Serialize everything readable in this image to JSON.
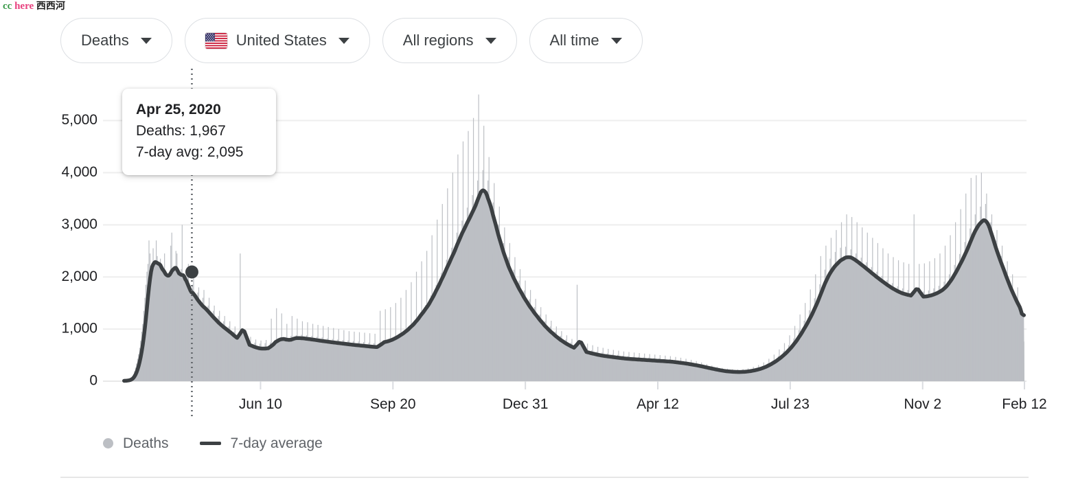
{
  "watermark": {
    "part1": "cc",
    "part2": "here",
    "part3": "西西河",
    "color1": "#3a9a4a",
    "color2": "#e8427f",
    "color3": "#1b1b1b"
  },
  "filters": [
    {
      "name": "metric",
      "label": "Deaths",
      "icon": "chevron-down-icon",
      "flag": false
    },
    {
      "name": "location",
      "label": "United States",
      "icon": "chevron-down-icon",
      "flag": true,
      "flag_name": "us-flag-icon"
    },
    {
      "name": "regions",
      "label": "All regions",
      "icon": "chevron-down-icon",
      "flag": false
    },
    {
      "name": "timerange",
      "label": "All time",
      "icon": "chevron-down-icon",
      "flag": false
    }
  ],
  "tooltip": {
    "date": "Apr 25, 2020",
    "line1": "Deaths: 1,967",
    "line2": "7-day avg: 2,095"
  },
  "legend": [
    {
      "label": "Deaths",
      "marker": "dot",
      "color": "#bcbfc4"
    },
    {
      "label": "7-day average",
      "marker": "line",
      "color": "#3c4043"
    }
  ],
  "colors": {
    "bars": "#bcbfc4",
    "area": "#bcbfc4",
    "line": "#3c4043",
    "grid": "#eeeeee",
    "text": "#202124",
    "muted_text": "#5f6368",
    "chip_border": "#dcdfe3",
    "divider": "#e6e6e6"
  },
  "chart_data": {
    "type": "bar",
    "title": "",
    "xlabel": "",
    "ylabel": "",
    "ylim": [
      0,
      5600
    ],
    "yticks": [
      0,
      1000,
      2000,
      3000,
      4000,
      5000
    ],
    "ytick_labels": [
      "0",
      "1,000",
      "2,000",
      "3,000",
      "4,000",
      "5,000"
    ],
    "xtick_labels": [
      "Jun 10",
      "Sep 20",
      "Dec 31",
      "Apr 12",
      "Jul 23",
      "Nov 2",
      "Feb 12"
    ],
    "xtick_positions": [
      0.152,
      0.299,
      0.446,
      0.593,
      0.74,
      0.887,
      1.0
    ],
    "grid": true,
    "legend_position": "bottom-left",
    "hover": {
      "x_fraction": 0.0758,
      "value": 1967,
      "avg": 2095,
      "label": "Apr 25, 2020"
    },
    "series": [
      {
        "name": "Deaths",
        "type": "bar",
        "color": "#bcbfc4",
        "values": [
          5,
          8,
          12,
          18,
          25,
          30,
          42,
          60,
          90,
          130,
          190,
          260,
          340,
          430,
          520,
          640,
          780,
          950,
          1100,
          1350,
          1600,
          1850,
          2100,
          2250,
          2700,
          2450,
          1900,
          2100,
          2550,
          2200,
          2050,
          2700,
          2400,
          1850,
          2000,
          2350,
          2200,
          1700,
          1900,
          2450,
          2100,
          1800,
          1750,
          2050,
          1967,
          2600,
          2850,
          2050,
          1750,
          1600,
          2500,
          2450,
          1900,
          1700,
          1650,
          2150,
          3000,
          1800,
          1600,
          1500,
          1400,
          2050,
          2250,
          1550,
          1400,
          1350,
          1850,
          2000,
          1500,
          1300,
          1200,
          1700,
          1800,
          1350,
          1200,
          1150,
          1600,
          1750,
          1250,
          1100,
          1050,
          1450,
          1600,
          1150,
          1000,
          980,
          1350,
          1450,
          1050,
          900,
          880,
          1250,
          1350,
          960,
          850,
          800,
          1150,
          1250,
          900,
          780,
          760,
          1050,
          1150,
          820,
          700,
          680,
          950,
          1050,
          760,
          640,
          620,
          880,
          2450,
          700,
          600,
          580,
          830,
          900,
          660,
          560,
          540,
          780,
          850,
          620,
          530,
          510,
          740,
          800,
          600,
          510,
          500,
          720,
          780,
          600,
          520,
          510,
          730,
          790,
          610,
          530,
          520,
          740,
          1200,
          640,
          560,
          550,
          780,
          1400,
          680,
          600,
          590,
          830,
          1300,
          700,
          620,
          610,
          850,
          1100,
          720,
          640,
          630,
          870,
          1250,
          740,
          650,
          640,
          880,
          1200,
          750,
          660,
          650,
          890,
          1150,
          740,
          650,
          640,
          880,
          1130,
          730,
          640,
          630,
          870,
          1100,
          720,
          630,
          620,
          850,
          1080,
          700,
          620,
          610,
          840,
          1060,
          690,
          610,
          600,
          820,
          1040,
          680,
          600,
          590,
          810,
          1020,
          670,
          590,
          580,
          800,
          1000,
          660,
          580,
          570,
          790,
          980,
          650,
          570,
          560,
          780,
          960,
          640,
          560,
          550,
          770,
          950,
          630,
          550,
          540,
          760,
          940,
          620,
          540,
          530,
          750,
          930,
          610,
          530,
          520,
          740,
          920,
          600,
          520,
          510,
          730,
          910,
          600,
          520,
          510,
          730,
          1350,
          610,
          530,
          520,
          740,
          1380,
          640,
          560,
          550,
          780,
          1420,
          680,
          600,
          590,
          830,
          1500,
          740,
          650,
          640,
          890,
          1600,
          800,
          700,
          690,
          960,
          1750,
          880,
          770,
          760,
          1060,
          1900,
          960,
          850,
          840,
          1180,
          2100,
          1080,
          950,
          940,
          1320,
          2300,
          1200,
          1050,
          1040,
          1460,
          2500,
          1350,
          1180,
          1170,
          1650,
          2800,
          1520,
          1330,
          1320,
          1850,
          3100,
          1700,
          1500,
          1480,
          2080,
          3400,
          1900,
          1680,
          1660,
          2330,
          3700,
          2100,
          1850,
          1830,
          2560,
          4000,
          2300,
          2050,
          2030,
          2850,
          4350,
          2500,
          2230,
          2200,
          3080,
          4600,
          2700,
          2400,
          2380,
          3330,
          4800,
          2900,
          2580,
          2550,
          3570,
          5050,
          3100,
          2800,
          2750,
          3850,
          5500,
          3350,
          2950,
          2900,
          4050,
          4900,
          3200,
          2800,
          2750,
          3850,
          4300,
          2900,
          2500,
          2450,
          3430,
          3800,
          2550,
          2200,
          2150,
          3000,
          3350,
          2250,
          1950,
          1900,
          2650,
          2950,
          2000,
          1720,
          1700,
          2380,
          2650,
          1800,
          1550,
          1530,
          2140,
          2380,
          1620,
          1400,
          1380,
          1930,
          2150,
          1460,
          1260,
          1240,
          1740,
          1930,
          1320,
          1140,
          1120,
          1570,
          1750,
          1190,
          1030,
          1010,
          1420,
          1580,
          1080,
          930,
          910,
          1280,
          1420,
          970,
          840,
          820,
          1150,
          1280,
          880,
          760,
          750,
          1050,
          1160,
          800,
          690,
          680,
          950,
          1050,
          730,
          630,
          620,
          870,
          960,
          670,
          580,
          570,
          800,
          880,
          620,
          540,
          530,
          740,
          810,
          580,
          500,
          490,
          690,
          1850,
          540,
          470,
          460,
          650,
          760,
          510,
          450,
          440,
          620,
          720,
          490,
          430,
          420,
          590,
          690,
          470,
          410,
          400,
          570,
          660,
          450,
          395,
          385,
          550,
          640,
          440,
          385,
          375,
          535,
          620,
          430,
          375,
          365,
          520,
          600,
          420,
          365,
          355,
          505,
          585,
          410,
          355,
          345,
          490,
          570,
          400,
          350,
          340,
          480,
          560,
          395,
          345,
          335,
          470,
          550,
          390,
          340,
          330,
          465,
          540,
          385,
          335,
          325,
          455,
          530,
          380,
          330,
          320,
          450,
          520,
          375,
          325,
          315,
          440,
          510,
          370,
          320,
          310,
          435,
          500,
          365,
          315,
          305,
          425,
          490,
          360,
          310,
          300,
          420,
          480,
          350,
          300,
          290,
          405,
          465,
          340,
          290,
          280,
          390,
          450,
          325,
          280,
          270,
          375,
          430,
          310,
          265,
          255,
          355,
          410,
          295,
          250,
          240,
          335,
          385,
          275,
          235,
          225,
          310,
          360,
          255,
          215,
          205,
          285,
          330,
          235,
          200,
          190,
          260,
          300,
          215,
          180,
          175,
          240,
          275,
          195,
          165,
          160,
          220,
          255,
          180,
          155,
          150,
          205,
          240,
          175,
          150,
          145,
          195,
          230,
          170,
          148,
          144,
          190,
          225,
          172,
          152,
          148,
          195,
          232,
          180,
          160,
          156,
          205,
          248,
          195,
          175,
          170,
          225,
          275,
          215,
          195,
          190,
          250,
          310,
          245,
          225,
          218,
          290,
          360,
          285,
          265,
          258,
          340,
          430,
          340,
          315,
          305,
          400,
          510,
          405,
          375,
          365,
          480,
          610,
          480,
          445,
          435,
          575,
          730,
          570,
          530,
          520,
          690,
          880,
          680,
          630,
          620,
          820,
          1060,
          810,
          750,
          740,
          980,
          1280,
          960,
          890,
          875,
          1160,
          1500,
          1130,
          1050,
          1030,
          1360,
          1760,
          1320,
          1230,
          1210,
          1590,
          2050,
          1540,
          1440,
          1410,
          1860,
          2400,
          1780,
          1670,
          1640,
          2140,
          2600,
          1960,
          1840,
          1810,
          2350,
          2750,
          2080,
          1950,
          1920,
          2480,
          2900,
          2150,
          2020,
          1990,
          2560,
          3050,
          2180,
          2030,
          2000,
          2580,
          3200,
          2150,
          1990,
          1960,
          2530,
          3150,
          2090,
          1930,
          1900,
          2450,
          3050,
          2020,
          1860,
          1830,
          2370,
          2950,
          1950,
          1790,
          1760,
          2280,
          2850,
          1870,
          1720,
          1690,
          2190,
          2750,
          1800,
          1650,
          1620,
          2100,
          2650,
          1730,
          1590,
          1560,
          2020,
          2550,
          1670,
          1530,
          1500,
          1940,
          2450,
          1610,
          1480,
          1450,
          1880,
          2380,
          1560,
          1430,
          1400,
          1820,
          2320,
          1520,
          1400,
          1370,
          1780,
          2280,
          1500,
          1380,
          1350,
          1750,
          2250,
          1480,
          1360,
          1330,
          1730,
          3200,
          1470,
          1350,
          1320,
          1720,
          2250,
          1470,
          1350,
          1320,
          1720,
          2260,
          1480,
          1360,
          1340,
          1740,
          2300,
          1510,
          1390,
          1360,
          1780,
          2360,
          1550,
          1430,
          1400,
          1830,
          2450,
          1610,
          1490,
          1460,
          1910,
          2600,
          1720,
          1600,
          1570,
          2050,
          2800,
          1860,
          1740,
          1710,
          2230,
          3050,
          2030,
          1900,
          1870,
          2440,
          3300,
          2210,
          2070,
          2040,
          2670,
          3600,
          2420,
          2280,
          2250,
          2930,
          3900,
          2650,
          2500,
          2460,
          3200,
          3950,
          2800,
          2650,
          2600,
          3350,
          4000,
          2850,
          2700,
          2650,
          3400,
          3600,
          2600,
          2450,
          2400,
          3050,
          3200,
          2300,
          2150,
          2100,
          2700,
          2900,
          2050,
          1900,
          1870,
          2400,
          2600,
          1800,
          1650,
          1620,
          2100,
          2300,
          1580,
          1430,
          1400,
          1820,
          2050,
          1380,
          1250,
          1220,
          1600,
          1800,
          1200,
          1080,
          1050,
          1400,
          900,
          760
        ]
      },
      {
        "name": "7-day average",
        "type": "line",
        "color": "#3c4043",
        "note": "smoothed 7-day rolling mean of Deaths; peaks ~2,230 (Apr 2020), ~1,150 (Aug 2020), ~3,400 (Jan 2021), ~200 (Jul 2021), ~2,120 (Sep 2021), ~2,650 (Feb 2022)"
      }
    ]
  }
}
